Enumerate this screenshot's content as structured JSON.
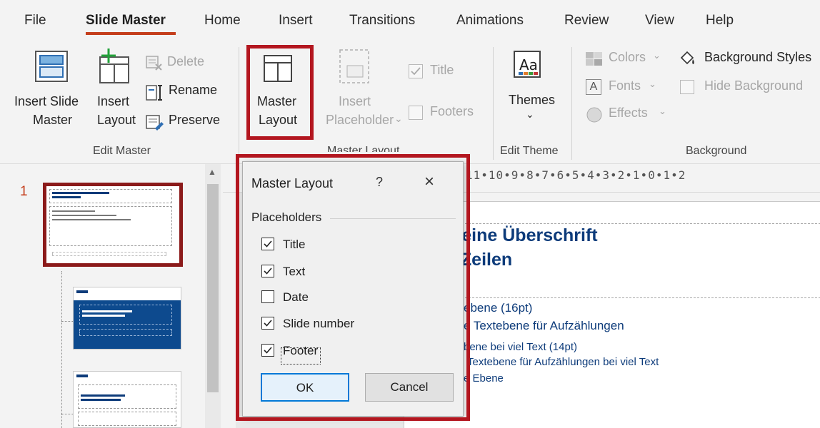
{
  "tabs": [
    {
      "label": "File"
    },
    {
      "label": "Slide Master"
    },
    {
      "label": "Home"
    },
    {
      "label": "Insert"
    },
    {
      "label": "Transitions"
    },
    {
      "label": "Animations"
    },
    {
      "label": "Review"
    },
    {
      "label": "View"
    },
    {
      "label": "Help"
    }
  ],
  "ribbon": {
    "edit_master": {
      "insert_slide_master_1": "Insert Slide",
      "insert_slide_master_2": "Master",
      "insert_layout_1": "Insert",
      "insert_layout_2": "Layout",
      "delete": "Delete",
      "rename": "Rename",
      "preserve": "Preserve",
      "group_label": "Edit Master"
    },
    "master_layout": {
      "master_layout_1": "Master",
      "master_layout_2": "Layout",
      "insert_placeholder_1": "Insert",
      "insert_placeholder_2": "Placeholder",
      "title_check": "Title",
      "footers_check": "Footers",
      "group_label": "Master Layout"
    },
    "edit_theme": {
      "themes": "Themes",
      "group_label": "Edit Theme"
    },
    "background": {
      "colors": "Colors",
      "fonts": "Fonts",
      "effects": "Effects",
      "background_styles": "Background Styles",
      "hide_background": "Hide Background",
      "group_label": "Background"
    }
  },
  "slides": {
    "number": "1"
  },
  "ruler": {
    "text": "11•10•9•8•7•6•5•4•3•2•1•0•1•2"
  },
  "slide_content": {
    "heading_line1": "t eine Überschrift",
    "heading_line2": "i Zeilen",
    "line1": "ebene (16pt)",
    "line2": "e Textebene für Aufzählungen",
    "line3": "bene bei viel Text (14pt)",
    "line4": "Textebene für Aufzählungen bei viel Text",
    "line5": "e Ebene"
  },
  "dialog": {
    "title": "Master Layout",
    "help": "?",
    "close": "×",
    "group_label": "Placeholders",
    "items": [
      {
        "label": "Title",
        "checked": true
      },
      {
        "label": "Text",
        "checked": true
      },
      {
        "label": "Date",
        "checked": false
      },
      {
        "label": "Slide number",
        "checked": true
      },
      {
        "label": "Footer",
        "checked": true
      }
    ],
    "ok": "OK",
    "cancel": "Cancel"
  },
  "colors": {
    "accent": "#c43e1c",
    "highlight": "#b3161f",
    "slide_blue": "#0d3b7a"
  }
}
